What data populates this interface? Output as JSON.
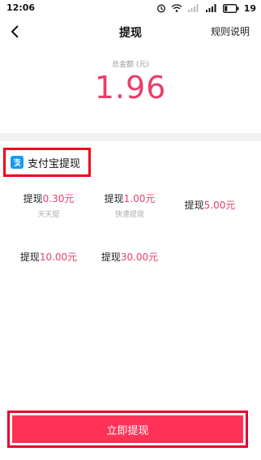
{
  "status": {
    "time": "12:06",
    "battery": "19"
  },
  "header": {
    "title": "提现",
    "rules": "规则说明"
  },
  "amount": {
    "label": "总金额 (元)",
    "value": "1.96"
  },
  "method": {
    "label": "支付宝提现"
  },
  "options": [
    {
      "prefix": "提现",
      "amount": "0.30元",
      "note": "天天提"
    },
    {
      "prefix": "提现",
      "amount": "1.00元",
      "note": "快速提现"
    },
    {
      "prefix": "提现",
      "amount": "5.00元",
      "note": ""
    },
    {
      "prefix": "提现",
      "amount": "10.00元",
      "note": ""
    },
    {
      "prefix": "提现",
      "amount": "30.00元",
      "note": ""
    }
  ],
  "submit": {
    "label": "立即提现"
  },
  "colors": {
    "accent": "#e8406a",
    "button": "#ff3156",
    "alipay": "#1a9bf0",
    "highlight": "#f0001c"
  },
  "icons": [
    "alarm-icon",
    "wifi-icon",
    "signal-icon",
    "battery-icon",
    "back-arrow-icon",
    "alipay-logo-icon"
  ]
}
